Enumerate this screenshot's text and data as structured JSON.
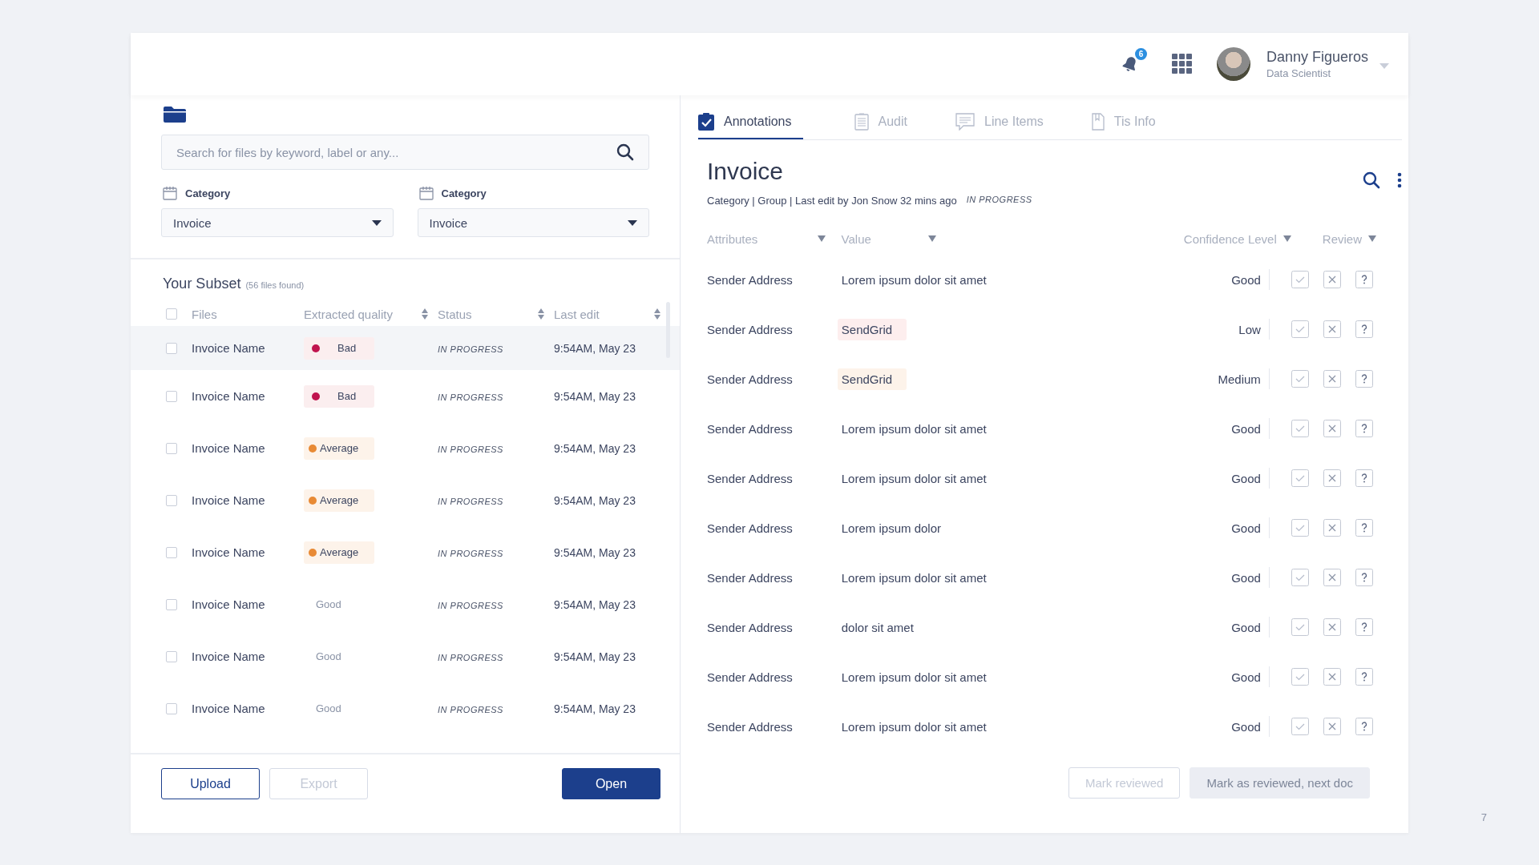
{
  "header": {
    "notification_count": "6",
    "user": {
      "name": "Danny Figueros",
      "role": "Data Scientist"
    }
  },
  "files_panel": {
    "search": {
      "placeholder": "Search for files by keyword, label or any..."
    },
    "filters": [
      {
        "label": "Category",
        "value": "Invoice"
      },
      {
        "label": "Category",
        "value": "Invoice"
      }
    ],
    "subset": {
      "title": "Your Subset",
      "count": "(56 files found)"
    },
    "columns": [
      {
        "label": "Files",
        "sortable": false
      },
      {
        "label": "Extracted quality",
        "sortable": true
      },
      {
        "label": "Status",
        "sortable": true
      },
      {
        "label": "Last edit",
        "sortable": true
      }
    ],
    "select_all_checked": false,
    "rows": [
      {
        "name": "Invoice Name",
        "quality": "Bad",
        "kind": "bad",
        "status": "IN PROGRESS",
        "last_edit": "9:54AM, May 23",
        "checked": false,
        "selected": true
      },
      {
        "name": "Invoice Name",
        "quality": "Bad",
        "kind": "bad",
        "status": "IN PROGRESS",
        "last_edit": "9:54AM, May 23",
        "checked": false,
        "selected": false
      },
      {
        "name": "Invoice Name",
        "quality": "Average",
        "kind": "average",
        "status": "IN PROGRESS",
        "last_edit": "9:54AM, May 23",
        "checked": false,
        "selected": false
      },
      {
        "name": "Invoice Name",
        "quality": "Average",
        "kind": "average",
        "status": "IN PROGRESS",
        "last_edit": "9:54AM, May 23",
        "checked": false,
        "selected": false
      },
      {
        "name": "Invoice Name",
        "quality": "Average",
        "kind": "average",
        "status": "IN PROGRESS",
        "last_edit": "9:54AM, May 23",
        "checked": false,
        "selected": false
      },
      {
        "name": "Invoice Name",
        "quality": "Good",
        "kind": "good",
        "status": "IN PROGRESS",
        "last_edit": "9:54AM, May 23",
        "checked": false,
        "selected": false
      },
      {
        "name": "Invoice Name",
        "quality": "Good",
        "kind": "good",
        "status": "IN PROGRESS",
        "last_edit": "9:54AM, May 23",
        "checked": false,
        "selected": false
      },
      {
        "name": "Invoice Name",
        "quality": "Good",
        "kind": "good",
        "status": "IN PROGRESS",
        "last_edit": "9:54AM, May 23",
        "checked": false,
        "selected": false
      }
    ],
    "buttons": [
      {
        "label": "Upload",
        "kind": "outline",
        "disabled": false
      },
      {
        "label": "Export",
        "kind": "outline",
        "disabled": true
      },
      {
        "label": "Open",
        "kind": "primary",
        "disabled": false
      }
    ]
  },
  "detail_panel": {
    "tabs": [
      {
        "label": "Annotations",
        "kind": "clipboard",
        "selected": true
      },
      {
        "label": "Audit",
        "kind": "document",
        "selected": false
      },
      {
        "label": "Line Items",
        "kind": "chat",
        "selected": false
      },
      {
        "label": "Tis Info",
        "kind": "page",
        "selected": false
      }
    ],
    "title": "Invoice",
    "meta": "Category | Group | Last edit by Jon Snow 32 mins ago",
    "status": "IN PROGRESS",
    "columns": [
      {
        "label": "Attributes"
      },
      {
        "label": "Value"
      },
      {
        "label": "Confidence Level"
      },
      {
        "label": "Review"
      }
    ],
    "rows": [
      {
        "attribute": "Sender Address",
        "value": "Lorem ipsum dolor sit amet",
        "confidence": "Good",
        "kind": "plain"
      },
      {
        "attribute": "Sender Address",
        "value": "SendGrid",
        "confidence": "Low",
        "kind": "low"
      },
      {
        "attribute": "Sender Address",
        "value": "SendGrid",
        "confidence": "Medium",
        "kind": "medium"
      },
      {
        "attribute": "Sender Address",
        "value": "Lorem ipsum dolor sit amet",
        "confidence": "Good",
        "kind": "plain"
      },
      {
        "attribute": "Sender Address",
        "value": "Lorem ipsum dolor sit amet",
        "confidence": "Good",
        "kind": "plain"
      },
      {
        "attribute": "Sender Address",
        "value": "Lorem ipsum dolor",
        "confidence": "Good",
        "kind": "plain"
      },
      {
        "attribute": "Sender Address",
        "value": "Lorem ipsum dolor sit amet",
        "confidence": "Good",
        "kind": "plain"
      },
      {
        "attribute": "Sender Address",
        "value": "dolor sit amet",
        "confidence": "Good",
        "kind": "plain"
      },
      {
        "attribute": "Sender Address",
        "value": "Lorem ipsum dolor sit amet",
        "confidence": "Good",
        "kind": "plain"
      },
      {
        "attribute": "Sender Address",
        "value": "Lorem ipsum dolor sit amet",
        "confidence": "Good",
        "kind": "plain"
      }
    ],
    "buttons": [
      {
        "label": "Mark reviewed",
        "kind": "outline",
        "disabled": true
      },
      {
        "label": "Mark as reviewed, next doc",
        "kind": "filled",
        "disabled": true
      }
    ]
  },
  "page_number": "7"
}
